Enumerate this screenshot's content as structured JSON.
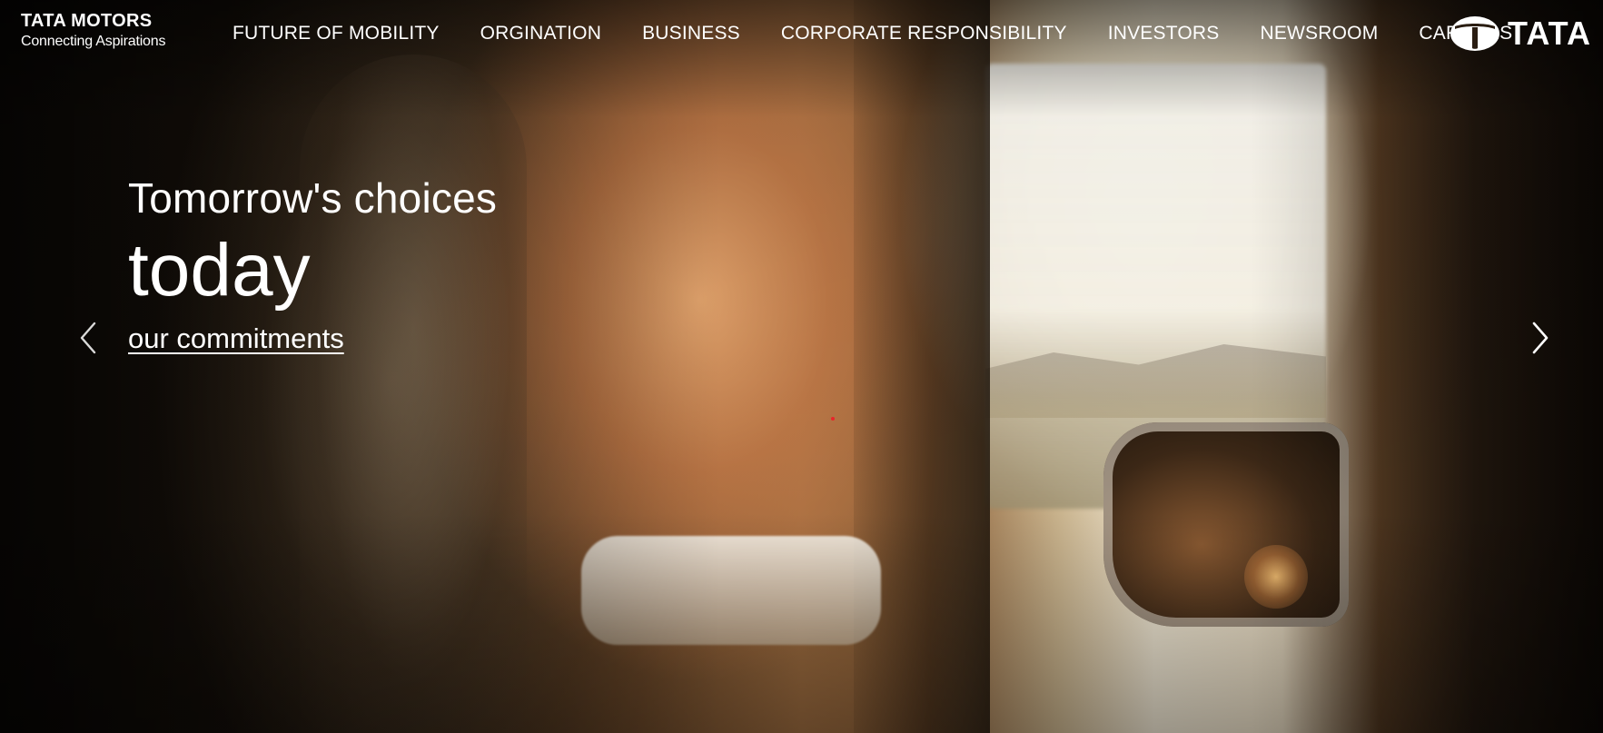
{
  "brand": {
    "name": "TATA MOTORS",
    "tagline": "Connecting Aspirations"
  },
  "nav": {
    "items": [
      {
        "label": "FUTURE OF MOBILITY"
      },
      {
        "label": "ORGINATION"
      },
      {
        "label": "BUSINESS"
      },
      {
        "label": "CORPORATE RESPONSIBILITY"
      },
      {
        "label": "INVESTORS"
      },
      {
        "label": "NEWSROOM"
      },
      {
        "label": "CAREERS"
      }
    ]
  },
  "group_logo": {
    "word": "TATA",
    "icon": "tata-emblem-icon"
  },
  "hero": {
    "subtitle": "Tomorrow's choices",
    "title": "today",
    "link_label": "our commitments",
    "prev_icon": "chevron-left-icon",
    "next_icon": "chevron-right-icon"
  },
  "colors": {
    "text": "#ffffff",
    "accent_dot": "#e8252a"
  }
}
